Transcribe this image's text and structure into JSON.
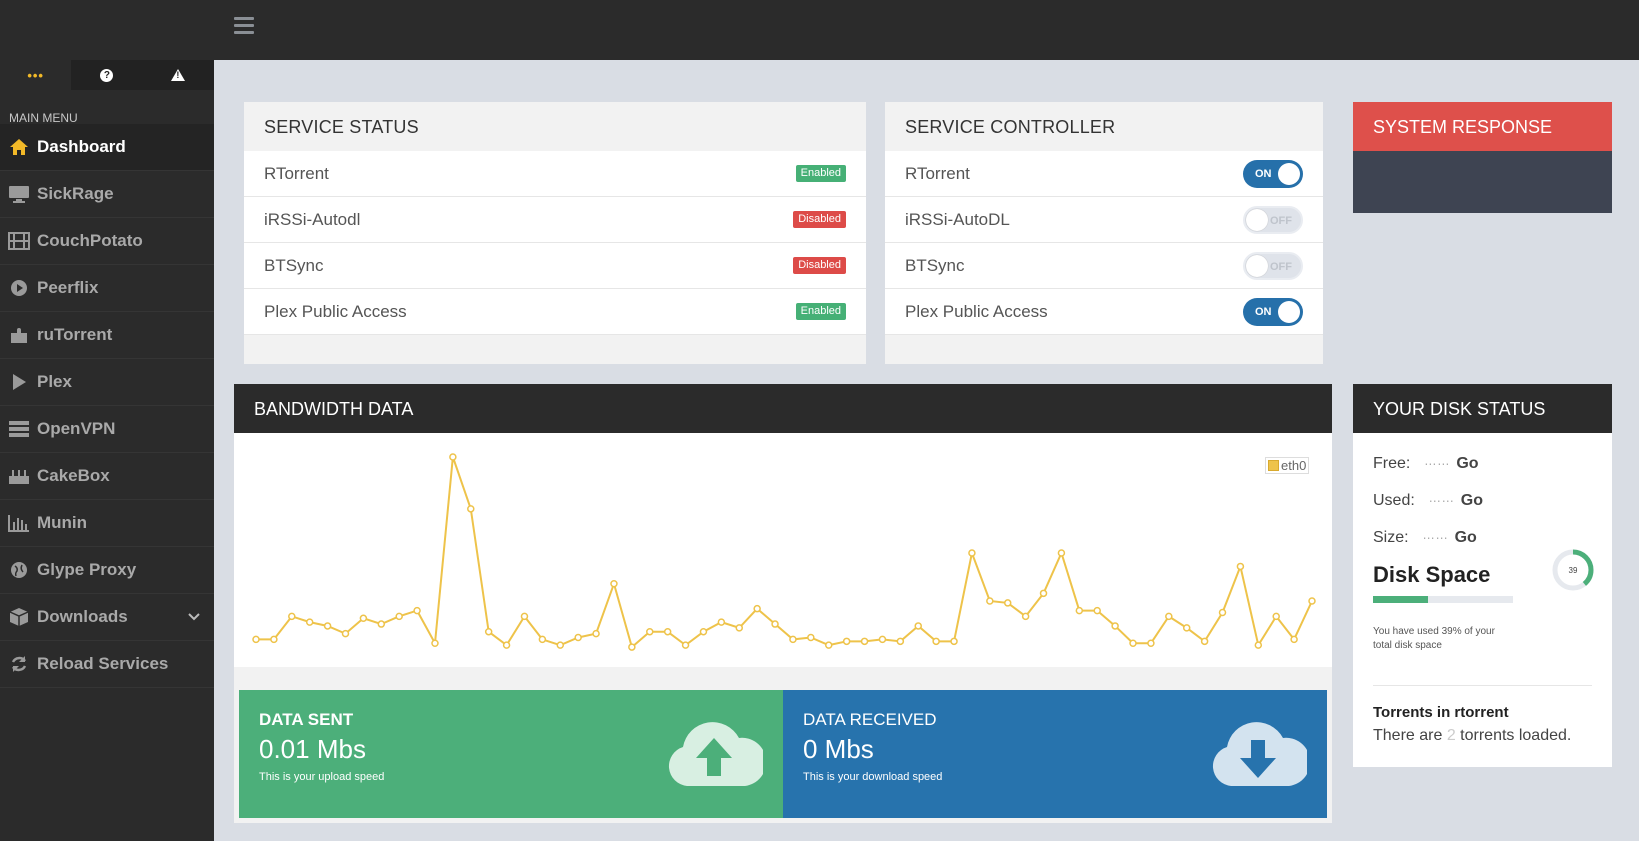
{
  "sidebar": {
    "menu_label": "MAIN MENU",
    "items": [
      {
        "label": "Dashboard",
        "icon": "home-icon"
      },
      {
        "label": "SickRage",
        "icon": "monitor-icon"
      },
      {
        "label": "CouchPotato",
        "icon": "film-icon"
      },
      {
        "label": "Peerflix",
        "icon": "play-circle-icon"
      },
      {
        "label": "ruTorrent",
        "icon": "puzzle-icon"
      },
      {
        "label": "Plex",
        "icon": "play-icon"
      },
      {
        "label": "OpenVPN",
        "icon": "server-icon"
      },
      {
        "label": "CakeBox",
        "icon": "cake-icon"
      },
      {
        "label": "Munin",
        "icon": "bar-chart-icon"
      },
      {
        "label": "Glype Proxy",
        "icon": "globe-icon"
      },
      {
        "label": "Downloads",
        "icon": "box-icon"
      },
      {
        "label": "Reload Services",
        "icon": "refresh-icon"
      }
    ],
    "top_icons": {
      "dots": "•••",
      "help": "?",
      "warning": "!"
    }
  },
  "service_status": {
    "title": "SERVICE STATUS",
    "rows": [
      {
        "name": "RTorrent",
        "status": "Enabled"
      },
      {
        "name": "iRSSi-Autodl",
        "status": "Disabled"
      },
      {
        "name": "BTSync",
        "status": "Disabled"
      },
      {
        "name": "Plex Public Access",
        "status": "Enabled"
      }
    ]
  },
  "service_controller": {
    "title": "SERVICE CONTROLLER",
    "rows": [
      {
        "name": "RTorrent",
        "toggle": "ON"
      },
      {
        "name": "iRSSi-AutoDL",
        "toggle": "OFF"
      },
      {
        "name": "BTSync",
        "toggle": "OFF"
      },
      {
        "name": "Plex Public Access",
        "toggle": "ON"
      }
    ]
  },
  "system_response": {
    "title": "SYSTEM RESPONSE"
  },
  "bandwidth": {
    "title": "BANDWIDTH DATA",
    "legend": "eth0",
    "color": "#eec34a"
  },
  "chart_data": {
    "type": "line",
    "series": [
      {
        "name": "eth0",
        "values": [
          5,
          5,
          17,
          14,
          12,
          8,
          16,
          13,
          17,
          20,
          3,
          100,
          73,
          9,
          2,
          17,
          5,
          2,
          6,
          8,
          34,
          1,
          9,
          9,
          2,
          9,
          14,
          11,
          21,
          13,
          5,
          6,
          2,
          4,
          4,
          5,
          4,
          12,
          4,
          4,
          50,
          25,
          24,
          17,
          29,
          50,
          20,
          20,
          12,
          3,
          3,
          17,
          11,
          4,
          19,
          43,
          2,
          17,
          5,
          25
        ]
      }
    ]
  },
  "data_sent": {
    "title": "DATA SENT",
    "value": "0.01 Mbs",
    "sub": "This is your upload speed",
    "color": "#4caf7a"
  },
  "data_received": {
    "title": "DATA RECEIVED",
    "value": "0 Mbs",
    "sub": "This is your download speed",
    "color": "#2773ad"
  },
  "disk": {
    "title": "YOUR DISK STATUS",
    "free_label": "Free:",
    "used_label": "Used:",
    "size_label": "Size:",
    "unit": "Go",
    "heading": "Disk Space",
    "percent": 39,
    "percent_label": "39",
    "note": "You have used 39% of your total disk space",
    "torrents_title": "Torrents in rtorrent",
    "torrents_prefix": "There are ",
    "torrents_count": "2",
    "torrents_suffix": " torrents loaded."
  }
}
